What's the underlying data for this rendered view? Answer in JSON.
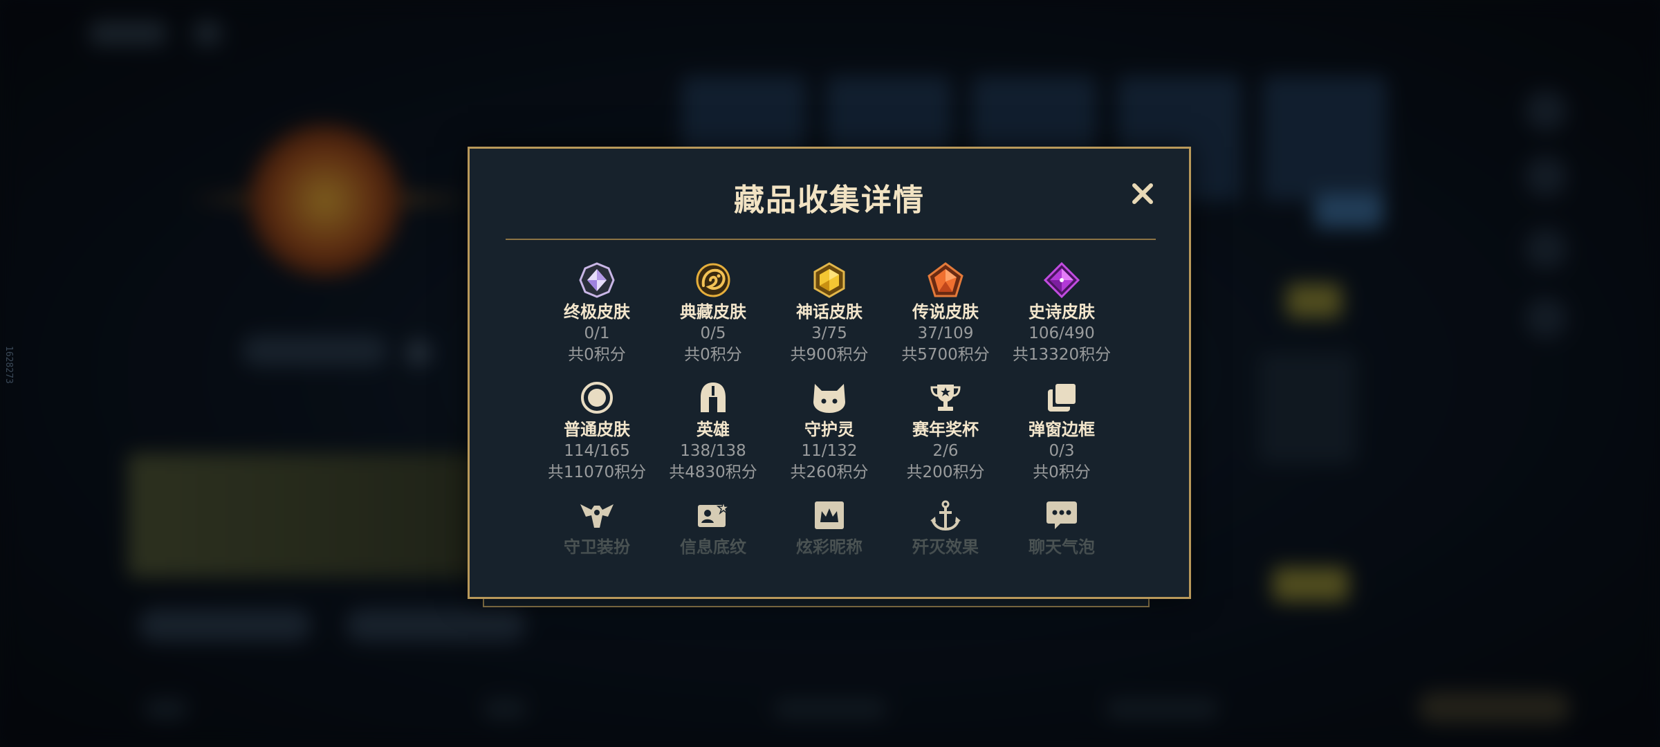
{
  "modal": {
    "title": "藏品收集详情",
    "close_label": "✕"
  },
  "side_id": "1628273",
  "categories": [
    {
      "name": "终极皮肤",
      "count": "0/1",
      "points": "共0积分",
      "icon": "ultimate-skin-gem-icon"
    },
    {
      "name": "典藏皮肤",
      "count": "0/5",
      "points": "共0积分",
      "icon": "collector-skin-dragon-icon"
    },
    {
      "name": "神话皮肤",
      "count": "3/75",
      "points": "共900积分",
      "icon": "mythic-skin-gem-icon"
    },
    {
      "name": "传说皮肤",
      "count": "37/109",
      "points": "共5700积分",
      "icon": "legendary-skin-gem-icon"
    },
    {
      "name": "史诗皮肤",
      "count": "106/490",
      "points": "共13320积分",
      "icon": "epic-skin-gem-icon"
    },
    {
      "name": "普通皮肤",
      "count": "114/165",
      "points": "共11070积分",
      "icon": "normal-skin-ring-icon"
    },
    {
      "name": "英雄",
      "count": "138/138",
      "points": "共4830积分",
      "icon": "helmet-icon"
    },
    {
      "name": "守护灵",
      "count": "11/132",
      "points": "共260积分",
      "icon": "guardian-spirit-icon"
    },
    {
      "name": "赛年奖杯",
      "count": "2/6",
      "points": "共200积分",
      "icon": "trophy-icon"
    },
    {
      "name": "弹窗边框",
      "count": "0/3",
      "points": "共0积分",
      "icon": "popup-frame-icon"
    },
    {
      "name": "守卫装扮",
      "icon": "ward-skin-icon"
    },
    {
      "name": "信息底纹",
      "icon": "info-card-icon"
    },
    {
      "name": "炫彩昵称",
      "icon": "colorful-nickname-icon"
    },
    {
      "name": "歼灭效果",
      "icon": "kill-effect-icon"
    },
    {
      "name": "聊天气泡",
      "icon": "chat-bubble-icon"
    }
  ],
  "colors": {
    "gold_border": "#b9995a",
    "panel_bg": "#17222c",
    "title_text": "#f2e3c3",
    "count_text": "#9a9c9d"
  }
}
